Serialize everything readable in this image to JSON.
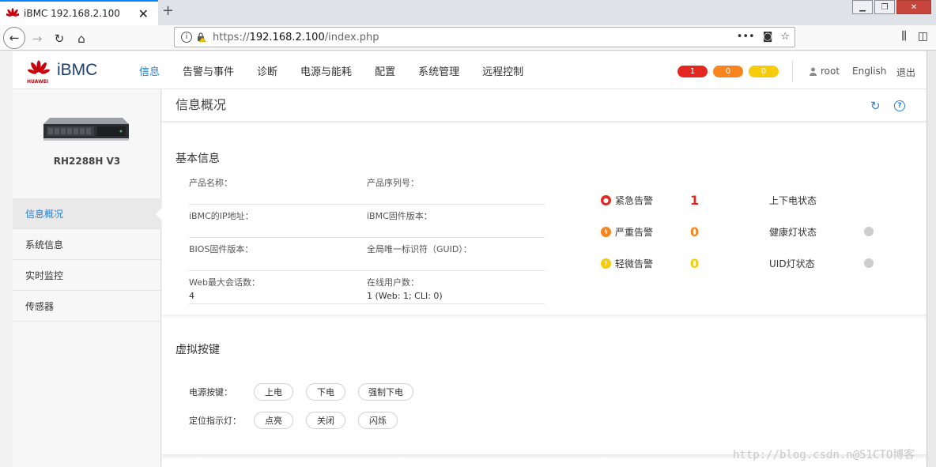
{
  "browser": {
    "tab_title": "iBMC 192.168.2.100",
    "url_prefix": "https://",
    "url_host": "192.168.2.100",
    "url_path": "/index.php",
    "more_actions": "•••"
  },
  "header": {
    "brand": "iBMC",
    "huawei_text": "HUAWEI",
    "nav": [
      "信息",
      "告警与事件",
      "诊断",
      "电源与能耗",
      "配置",
      "系统管理",
      "远程控制"
    ],
    "active_nav": "信息",
    "alarm_counts": {
      "critical": "1",
      "major": "0",
      "minor": "0"
    },
    "colors": {
      "critical": "#e5281f",
      "major": "#f7841d",
      "minor": "#f5cc0b",
      "accent": "#2a7fd4"
    },
    "user": "root",
    "language": "English",
    "logout": "退出"
  },
  "sidebar": {
    "model": "RH2288H V3",
    "items": [
      "信息概况",
      "系统信息",
      "实时监控",
      "传感器"
    ],
    "active_item": "信息概况"
  },
  "main": {
    "page_title": "信息概况",
    "basic_info_title": "基本信息",
    "info": [
      {
        "label": "产品名称：",
        "value": ""
      },
      {
        "label": "产品序列号：",
        "value": ""
      },
      {
        "label": "iBMC的IP地址：",
        "value": ""
      },
      {
        "label": "iBMC固件版本：",
        "value": ""
      },
      {
        "label": "BIOS固件版本：",
        "value": ""
      },
      {
        "label": "全局唯一标识符（GUID）：",
        "value": ""
      },
      {
        "label": "Web最大会话数：",
        "value": "4"
      },
      {
        "label": "在线用户数：",
        "value": "1 (Web: 1; CLI: 0)"
      }
    ],
    "alarms": [
      {
        "label": "紧急告警",
        "count": "1",
        "status_label": "上下电状态"
      },
      {
        "label": "严重告警",
        "count": "0",
        "status_label": "健康灯状态"
      },
      {
        "label": "轻微告警",
        "count": "0",
        "status_label": "UID灯状态"
      }
    ],
    "virtual_keys_title": "虚拟按键",
    "power_label": "电源按键：",
    "power_buttons": [
      "上电",
      "下电",
      "强制下电"
    ],
    "led_label": "定位指示灯：",
    "led_buttons": [
      "点亮",
      "关闭",
      "闪烁"
    ],
    "watermark": "http://blog.csdn.n@51CTO博客"
  }
}
